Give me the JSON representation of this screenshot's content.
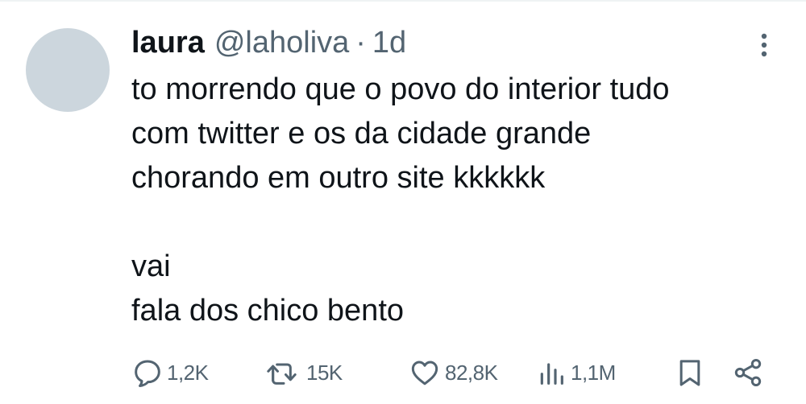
{
  "tweet": {
    "author": {
      "display_name": "laura",
      "handle": "@laholiva"
    },
    "separator": "·",
    "timestamp": "1d",
    "text_lines": [
      "to morrendo que o povo do interior tudo",
      "com twitter e os da cidade grande",
      "chorando em outro site kkkkkk",
      "",
      "vai",
      "fala dos chico bento"
    ]
  },
  "actions": {
    "reply": {
      "icon": "reply-icon",
      "count": "1,2K"
    },
    "retweet": {
      "icon": "retweet-icon",
      "count": "15K"
    },
    "like": {
      "icon": "heart-icon",
      "count": "82,8K"
    },
    "views": {
      "icon": "views-icon",
      "count": "1,1M"
    },
    "bookmark": {
      "icon": "bookmark-icon"
    },
    "share": {
      "icon": "share-icon"
    }
  },
  "colors": {
    "text_primary": "#0f1419",
    "text_secondary": "#536471",
    "avatar_placeholder": "#ccd6dd",
    "divider": "#eff3f4",
    "background": "#ffffff"
  }
}
